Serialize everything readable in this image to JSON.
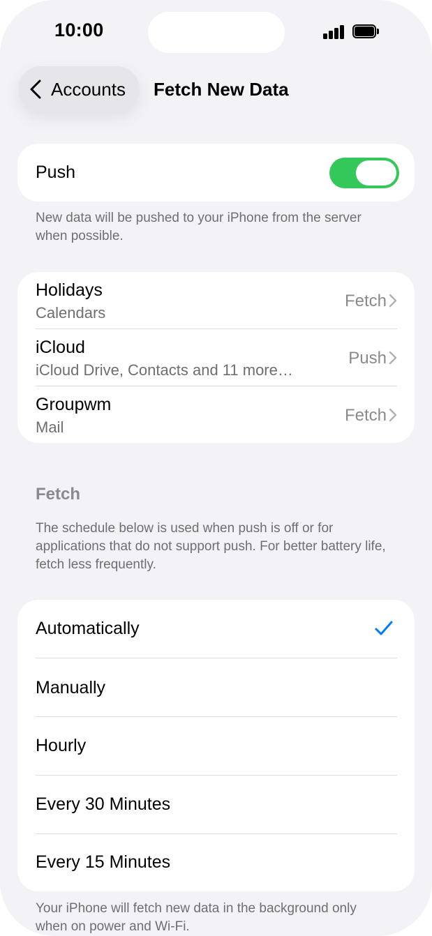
{
  "status_bar": {
    "time": "10:00"
  },
  "nav": {
    "back_label": "Accounts",
    "title": "Fetch New Data"
  },
  "push": {
    "label": "Push",
    "enabled": true,
    "footnote": "New data will be pushed to your iPhone from the server when possible."
  },
  "accounts": [
    {
      "title": "Holidays",
      "subtitle": "Calendars",
      "value": "Fetch"
    },
    {
      "title": "iCloud",
      "subtitle": "iCloud Drive, Contacts and 11 more…",
      "value": "Push"
    },
    {
      "title": "Groupwm",
      "subtitle": "Mail",
      "value": "Fetch"
    }
  ],
  "fetch_section": {
    "header": "Fetch",
    "description": "The schedule below is used when push is off or for applications that do not support push. For better battery life, fetch less frequently."
  },
  "schedule": {
    "options": [
      "Automatically",
      "Manually",
      "Hourly",
      "Every 30 Minutes",
      "Every 15 Minutes"
    ],
    "selected": "Automatically",
    "footnote": "Your iPhone will fetch new data in the background only when on power and Wi-Fi."
  },
  "colors": {
    "toggle_on": "#34c759",
    "accent": "#007aff",
    "background": "#f2f2f7"
  }
}
